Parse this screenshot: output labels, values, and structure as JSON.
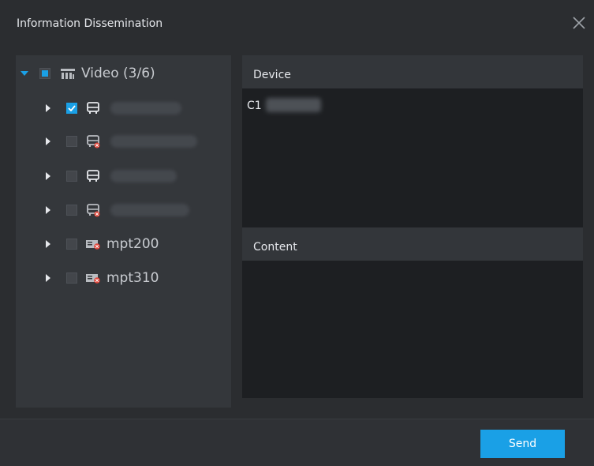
{
  "window": {
    "title": "Information Dissemination"
  },
  "tree": {
    "root": {
      "label": "Video (3/6)"
    },
    "children": [
      {
        "label": "",
        "checked": true,
        "icon": "bus-icon"
      },
      {
        "label": "",
        "checked": false,
        "icon": "bus-offline-icon"
      },
      {
        "label": "",
        "checked": false,
        "icon": "bus-icon"
      },
      {
        "label": "",
        "checked": false,
        "icon": "bus-offline-icon"
      },
      {
        "label": "mpt200",
        "checked": false,
        "icon": "terminal-offline-icon"
      },
      {
        "label": "mpt310",
        "checked": false,
        "icon": "terminal-offline-icon"
      }
    ]
  },
  "device": {
    "header": "Device",
    "value": "C1"
  },
  "content": {
    "header": "Content",
    "value": ""
  },
  "footer": {
    "send_label": "Send"
  },
  "colors": {
    "accent": "#1aa0e6",
    "offline": "#e2483c"
  }
}
